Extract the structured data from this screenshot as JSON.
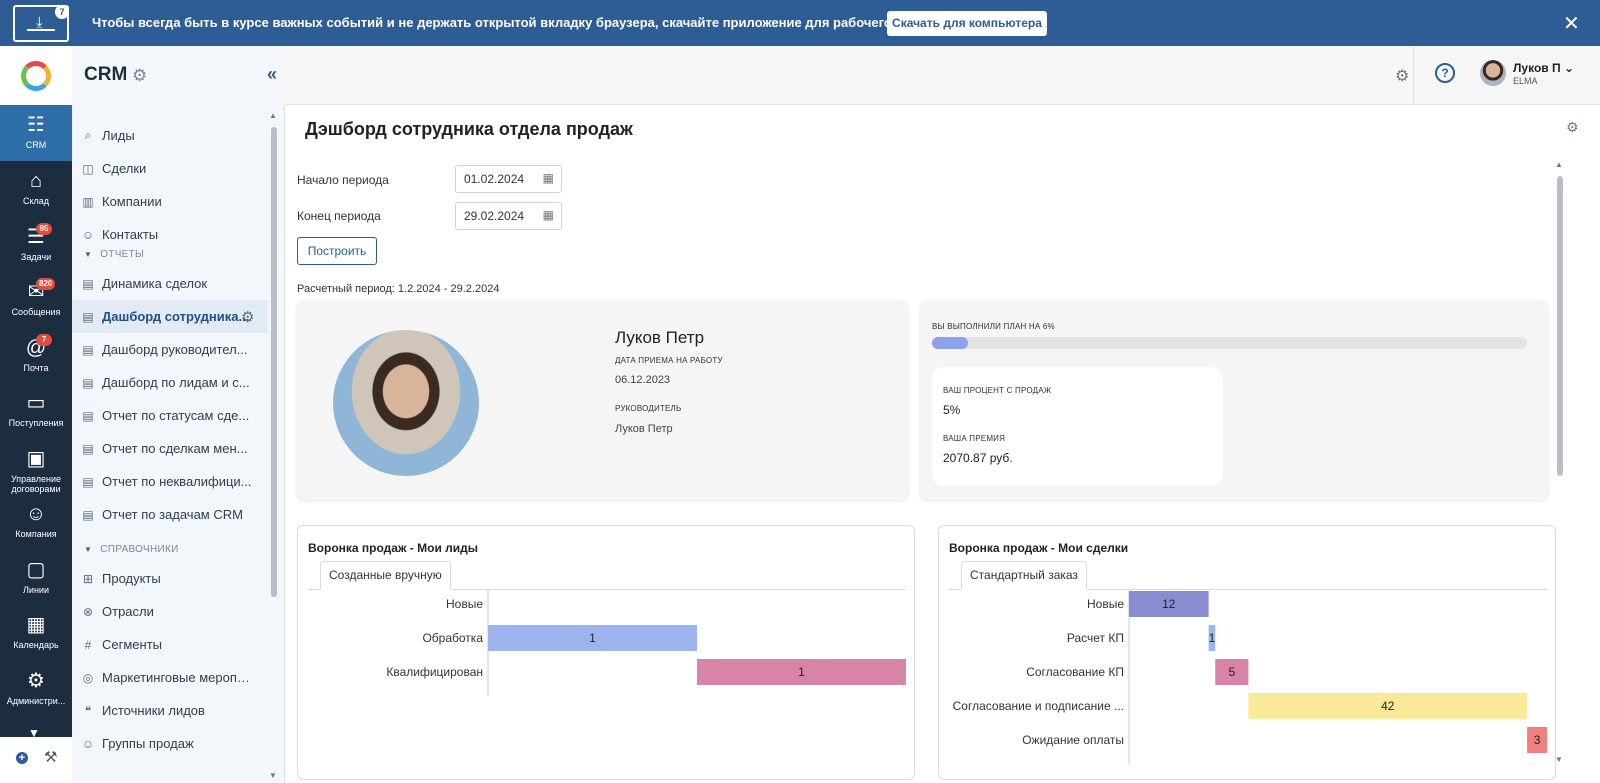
{
  "banner": {
    "badge": "7",
    "text": "Чтобы всегда быть в курсе важных событий и не держать открытой вкладку браузера, скачайте приложение для рабочего стола.",
    "button": "Скачать для компьютера",
    "close": "✕"
  },
  "rail": {
    "items": [
      {
        "label": "CRM",
        "icon": "contacts-icon",
        "glyph": "☷",
        "badge": null
      },
      {
        "label": "Склад",
        "icon": "warehouse-icon",
        "glyph": "⌂",
        "badge": null
      },
      {
        "label": "Задачи",
        "icon": "tasks-icon",
        "glyph": "☰",
        "badge": "95"
      },
      {
        "label": "Сообщения",
        "icon": "messages-icon",
        "glyph": "✉",
        "badge": "820"
      },
      {
        "label": "Почта",
        "icon": "mail-icon",
        "glyph": "@",
        "badge": "7"
      },
      {
        "label": "Поступления",
        "icon": "inbox-icon",
        "glyph": "▭",
        "badge": null
      },
      {
        "label": "Управление договорами",
        "icon": "briefcase-icon",
        "glyph": "▣",
        "badge": null
      },
      {
        "label": "Компания",
        "icon": "team-icon",
        "glyph": "☺",
        "badge": null
      },
      {
        "label": "Линии",
        "icon": "chat-icon",
        "glyph": "▢",
        "badge": null
      },
      {
        "label": "Календарь",
        "icon": "calendar-icon",
        "glyph": "▦",
        "badge": null
      },
      {
        "label": "Администри...",
        "icon": "settings-icon",
        "glyph": "⚙",
        "badge": null
      }
    ],
    "more": "▼",
    "add": "+",
    "tools": "🔧"
  },
  "sidebar": {
    "title": "CRM",
    "collapse": "«",
    "items": [
      {
        "label": "Лиды",
        "icon": "search-icon",
        "glyph": "⌕"
      },
      {
        "label": "Сделки",
        "icon": "deals-icon",
        "glyph": "◫"
      },
      {
        "label": "Компании",
        "icon": "building-icon",
        "glyph": "▥"
      },
      {
        "label": "Контакты",
        "icon": "contacts-icon",
        "glyph": "☺"
      }
    ],
    "reports_section": "ОТЧЕТЫ",
    "reports": [
      {
        "label": "Динамика сделок"
      },
      {
        "label": "Дашборд сотрудника..."
      },
      {
        "label": "Дашборд руководител..."
      },
      {
        "label": "Дашборд по лидам и с..."
      },
      {
        "label": "Отчет по статусам сде..."
      },
      {
        "label": "Отчет по сделкам мен..."
      },
      {
        "label": "Отчет по неквалифици..."
      },
      {
        "label": "Отчет по задачам CRM"
      }
    ],
    "refs_section": "СПРАВОЧНИКИ",
    "refs": [
      {
        "label": "Продукты",
        "icon": "grid-icon",
        "glyph": "⊞"
      },
      {
        "label": "Отрасли",
        "icon": "industry-icon",
        "glyph": "⊗"
      },
      {
        "label": "Сегменты",
        "icon": "hash-icon",
        "glyph": "#"
      },
      {
        "label": "Маркетинговые мероприя...",
        "icon": "target-icon",
        "glyph": "◎"
      },
      {
        "label": "Источники лидов",
        "icon": "quote-icon",
        "glyph": "❝"
      },
      {
        "label": "Группы продаж",
        "icon": "group-icon",
        "glyph": "☺"
      }
    ]
  },
  "topbar": {
    "help": "?",
    "user_name": "Луков П",
    "user_caret": "⌄",
    "org": "ELMA"
  },
  "main": {
    "title": "Дэшборд сотрудника отдела продаж",
    "start_label": "Начало периода",
    "start_value": "01.02.2024",
    "end_label": "Конец периода",
    "end_value": "29.02.2024",
    "build_button": "Построить",
    "calc_period": "Расчетный период: 1.2.2024 - 29.2.2024"
  },
  "employee": {
    "name": "Луков Петр",
    "hire_label": "ДАТА ПРИЕМА НА РАБОТУ",
    "hire_date": "06.12.2023",
    "manager_label": "РУКОВОДИТЕЛЬ",
    "manager": "Луков Петр"
  },
  "plan": {
    "label": "ВЫ ВЫПОЛНИЛИ ПЛАН НА 6%",
    "percent": 6,
    "bar_color": "#8ea1ef",
    "sales_pct_label": "ВАШ ПРОЦЕНТ С ПРОДАЖ",
    "sales_pct": "5%",
    "bonus_label": "ВАША ПРЕМИЯ",
    "bonus": "2070.87 руб."
  },
  "chart_data": [
    {
      "type": "bar",
      "title": "Воронка продаж - Мои лиды",
      "tab": "Созданные вручную",
      "categories": [
        "Новые",
        "Обработка",
        "Квалифицирован"
      ],
      "values": [
        0,
        1,
        1
      ],
      "colors": [
        "#9db4ef",
        "#9db4ef",
        "#d884a8"
      ]
    },
    {
      "type": "bar",
      "title": "Воронка продаж - Мои сделки",
      "tab": "Стандартный заказ",
      "categories": [
        "Новые",
        "Расчет КП",
        "Согласование КП",
        "Согласование и подписание ...",
        "Ожидание оплаты"
      ],
      "values": [
        12,
        1,
        5,
        42,
        3
      ],
      "colors": [
        "#8b8dd2",
        "#9db4ef",
        "#d884a8",
        "#fbe99a",
        "#f08080"
      ]
    }
  ]
}
